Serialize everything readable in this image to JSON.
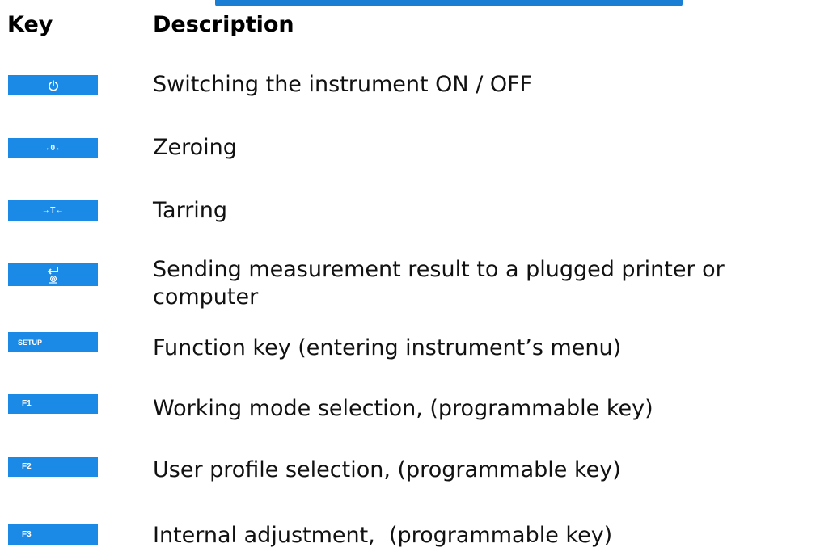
{
  "header": {
    "key_label": "Key",
    "description_label": "Description"
  },
  "colors": {
    "key_background": "#1a8ae6",
    "key_text": "#ffffff",
    "accent_bar": "#1a7fd4"
  },
  "rows": [
    {
      "key_icon": "power-icon",
      "key_text": "",
      "description": "Switching the instrument ON / OFF"
    },
    {
      "key_icon": "zero-icon",
      "key_text": "→0←",
      "description": "Zeroing"
    },
    {
      "key_icon": "tare-icon",
      "key_text": "→T←",
      "description": "Tarring"
    },
    {
      "key_icon": "print-enter-icon",
      "key_text": "",
      "description": "Sending measurement result to a plugged printer or computer"
    },
    {
      "key_icon": "",
      "key_text": "SETUP",
      "description": "Function key (entering instrument’s menu)"
    },
    {
      "key_icon": "",
      "key_text": "F1",
      "description": "Working mode selection, (programmable key)"
    },
    {
      "key_icon": "",
      "key_text": "F2",
      "description": "User profile selection, (programmable key)"
    },
    {
      "key_icon": "",
      "key_text": "F3",
      "description": "Internal adjustment,  (programmable key)"
    }
  ]
}
